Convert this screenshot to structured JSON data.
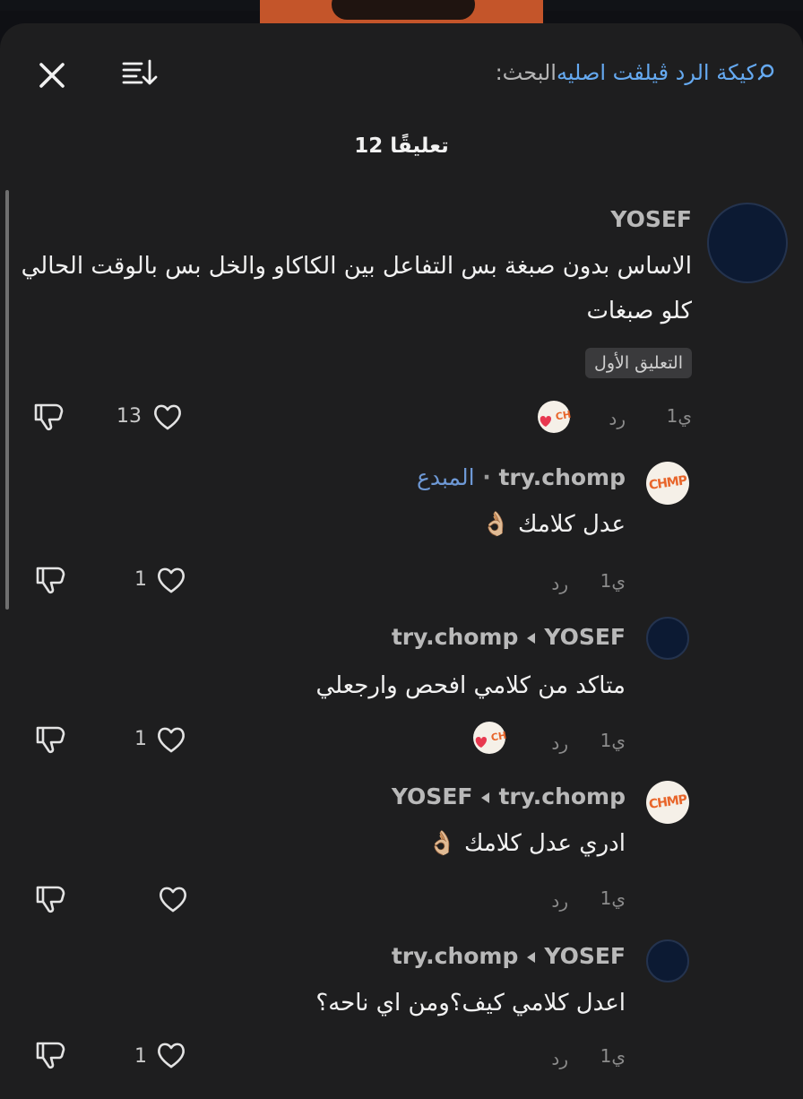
{
  "search": {
    "label": "البحث:",
    "query": "كيكة الرد ڤيلڤت اصليه"
  },
  "comments_header": {
    "count_label": "12 تعليقًا"
  },
  "comments": [
    {
      "username": "YOSEF",
      "text": "الاساس بدون صبغة بس التفاعل بين الكاكاو والخل بس بالوقت الحالي كلو صبغات",
      "badge": "التعليق الأول",
      "time": "1ي",
      "reply_label": "رد",
      "likes": "13"
    },
    {
      "username": "try.chomp",
      "creator_label": "المبدع",
      "text": "عدل كلامك 👌🏼",
      "time": "1ي",
      "reply_label": "رد",
      "likes": "1"
    },
    {
      "username": "YOSEF",
      "reply_to": "try.chomp",
      "text": "متاكد من كلامي افحص وارجعلي",
      "time": "1ي",
      "reply_label": "رد",
      "likes": "1"
    },
    {
      "username": "try.chomp",
      "reply_to": "YOSEF",
      "text": "ادري عدل كلامك 👌🏼",
      "time": "1ي",
      "reply_label": "رد",
      "likes": ""
    },
    {
      "username": "YOSEF",
      "reply_to": "try.chomp",
      "text": "اعدل كلامي كيف؟ومن اي ناحه؟",
      "time": "1ي",
      "reply_label": "رد",
      "likes": "1"
    }
  ],
  "avatar_text": "CHMP",
  "colors": {
    "sheet": "#1e1e1f",
    "link": "#65a9f0",
    "creator": "#6e99d6",
    "liked_heart": "#e8384f"
  },
  "icons": [
    "close-icon",
    "sort-icon",
    "search-icon",
    "heart-icon",
    "dislike-icon"
  ]
}
